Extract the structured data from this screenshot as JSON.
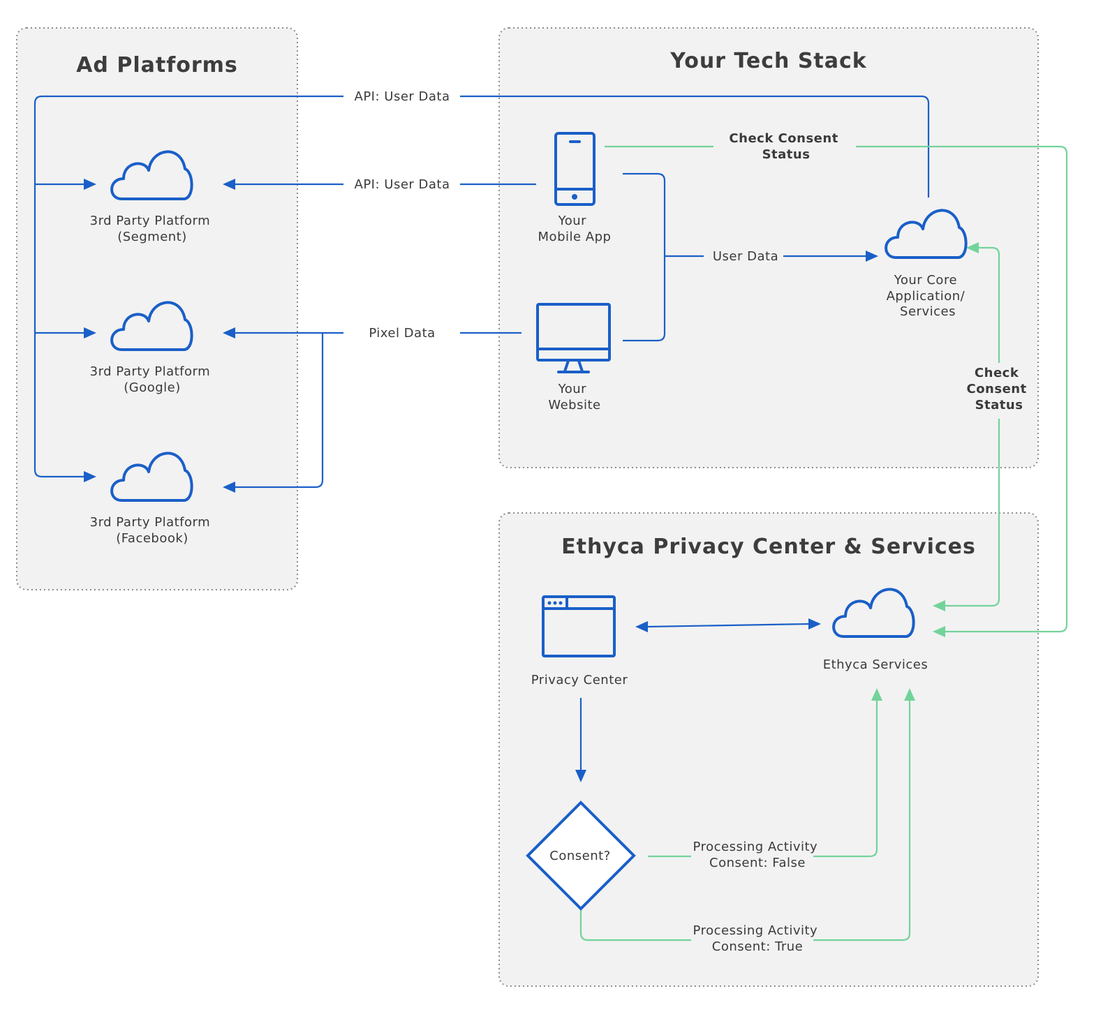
{
  "groups": {
    "ad_platforms": "Ad Platforms",
    "tech_stack": "Your Tech Stack",
    "ethyca": "Ethyca Privacy Center & Services"
  },
  "platforms": {
    "segment": [
      "3rd Party Platform",
      "(Segment)"
    ],
    "google": [
      "3rd Party Platform",
      "(Google)"
    ],
    "facebook": [
      "3rd Party Platform",
      "(Facebook)"
    ]
  },
  "tech": {
    "mobile_app": [
      "Your",
      "Mobile App"
    ],
    "website": [
      "Your",
      "Website"
    ],
    "core": [
      "Your Core",
      "Application/",
      "Services"
    ]
  },
  "ethyca": {
    "privacy_center": "Privacy Center",
    "services": "Ethyca Services",
    "decision": "Consent?"
  },
  "edges": {
    "api_top": "API: User Data",
    "api_mid": "API: User Data",
    "pixel": "Pixel Data",
    "user_data": "User Data",
    "check_top": [
      "Check Consent",
      "Status"
    ],
    "check_side": [
      "Check",
      "Consent",
      "Status"
    ],
    "false_path": [
      "Processing Activity",
      "Consent: False"
    ],
    "true_path": [
      "Processing Activity",
      "Consent: True"
    ]
  },
  "colors": {
    "flow": "#1a5fc8",
    "consent": "#72d39a",
    "panel": "#f2f2f2"
  },
  "icons": {
    "platforms": "cloud-icon",
    "mobile_app": "mobile-phone-icon",
    "website": "desktop-monitor-icon",
    "core": "cloud-icon",
    "privacy_center": "browser-window-icon",
    "services": "cloud-icon"
  }
}
